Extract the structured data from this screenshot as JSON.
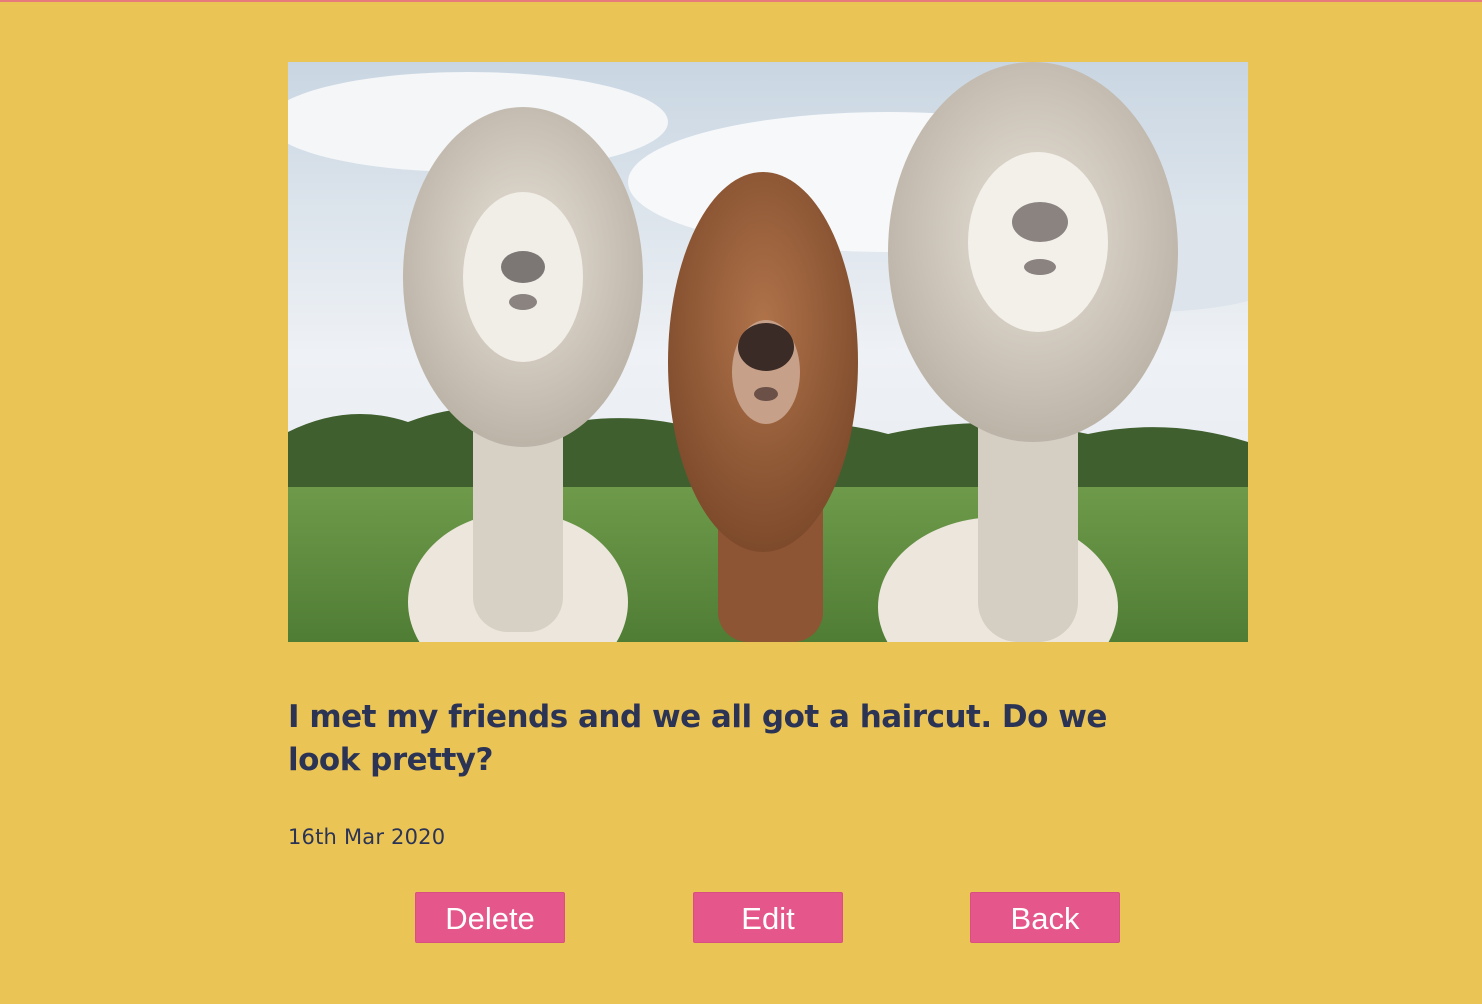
{
  "post": {
    "image_alt": "Three alpacas with haircuts standing in a grassy field",
    "caption": "I met my friends and we all got a haircut. Do we look pretty?",
    "date": "16th Mar 2020"
  },
  "actions": {
    "delete_label": "Delete",
    "edit_label": "Edit",
    "back_label": "Back"
  },
  "colors": {
    "background": "#ebc456",
    "text": "#2b3454",
    "button": "#e5568a",
    "button_text": "#ffffff"
  }
}
